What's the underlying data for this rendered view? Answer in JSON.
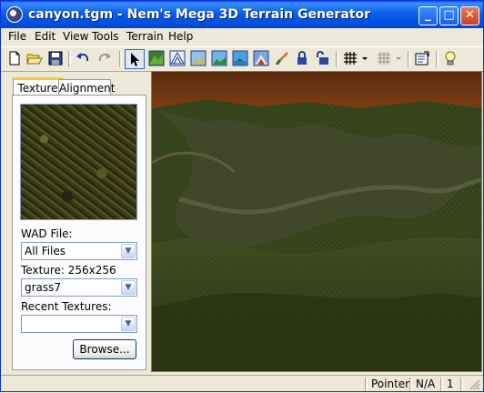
{
  "window": {
    "title": "canyon.tgm - Nem's Mega 3D Terrain Generator"
  },
  "menu": [
    "File",
    "Edit",
    "View",
    "Tools",
    "Terrain",
    "Help"
  ],
  "toolbar": {
    "icons": [
      "new-file-icon",
      "open-folder-icon",
      "save-icon",
      "undo-icon",
      "redo-icon",
      "pointer-icon",
      "terrain-view-1-icon",
      "terrain-view-2-icon",
      "terrain-view-3-icon",
      "terrain-view-4-icon",
      "terrain-view-5-icon",
      "terrain-view-6-icon",
      "paint-brush-icon",
      "lock-icon",
      "unlock-icon",
      "grid-icon",
      "grid-dropdown-icon",
      "grid-alt-icon",
      "properties-icon",
      "lightbulb-icon"
    ]
  },
  "tabs": {
    "texture": "Texture",
    "alignment": "Alignment"
  },
  "panel": {
    "wad_label": "WAD File:",
    "wad_value": "All Files",
    "texture_label": "Texture: 256x256",
    "texture_value": "grass7",
    "recent_label": "Recent Textures:",
    "recent_value": "",
    "browse": "Browse..."
  },
  "status": {
    "mode": "Pointer",
    "coord": "N/A",
    "count": "1"
  },
  "colors": {
    "title_bar": "#0a5fea",
    "window_bg": "#ece9d8",
    "sky_orange": "#d8751e",
    "grass_dark": "#2e3a14"
  }
}
